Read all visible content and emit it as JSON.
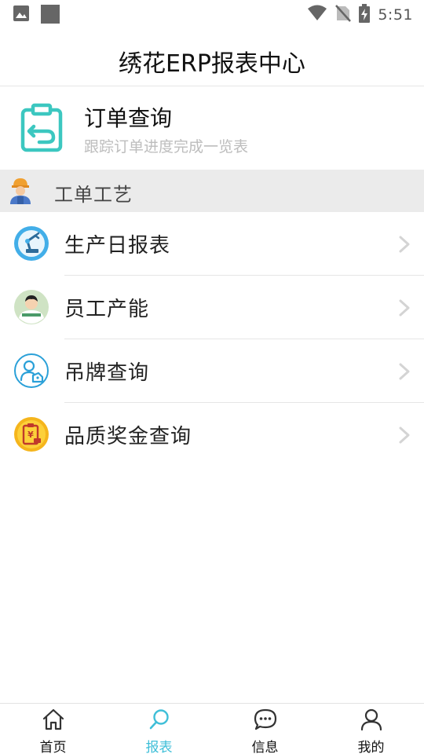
{
  "status_bar": {
    "time": "5:51"
  },
  "header": {
    "title": "绣花ERP报表中心"
  },
  "order_card": {
    "title": "订单查询",
    "subtitle": "跟踪订单进度完成一览表"
  },
  "section": {
    "title": "工单工艺"
  },
  "menu": [
    {
      "label": "生产日报表",
      "icon": "robot-arm-icon"
    },
    {
      "label": "员工产能",
      "icon": "worker-avatar-icon"
    },
    {
      "label": "吊牌查询",
      "icon": "user-tag-icon"
    },
    {
      "label": "品质奖金查询",
      "icon": "bonus-clipboard-icon"
    }
  ],
  "bottom_nav": [
    {
      "label": "首页",
      "icon": "home-icon",
      "active": false
    },
    {
      "label": "报表",
      "icon": "search-icon",
      "active": true
    },
    {
      "label": "信息",
      "icon": "chat-icon",
      "active": false
    },
    {
      "label": "我的",
      "icon": "user-icon",
      "active": false
    }
  ],
  "colors": {
    "accent": "#3fbfd8",
    "teal_icon": "#3cc7c0",
    "section_bg": "#ebebeb"
  }
}
